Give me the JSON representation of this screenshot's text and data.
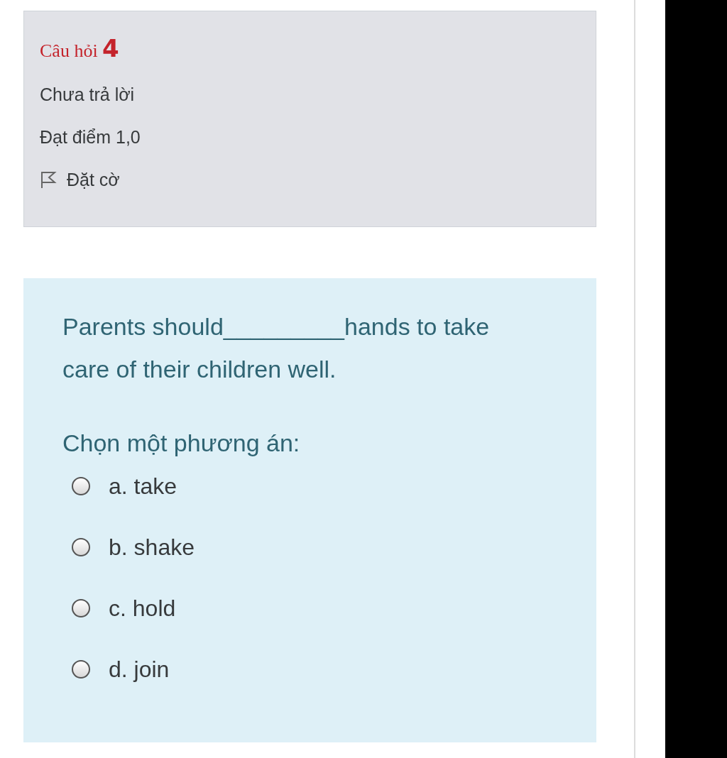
{
  "info": {
    "title": "Câu hỏi **4**",
    "status": "Chưa trả lời",
    "grade": "Đạt điểm 1,0",
    "flag": {
      "label": "Đặt cờ",
      "flagged": false
    }
  },
  "question": {
    "text": "Parents should_________hands to take care of their children well.",
    "prompt": "Chọn một phương án:",
    "options": [
      {
        "label": "a. take",
        "selected": false
      },
      {
        "label": "b. shake",
        "selected": false
      },
      {
        "label": "c. hold",
        "selected": false
      },
      {
        "label": "d. join",
        "selected": false
      }
    ]
  }
}
